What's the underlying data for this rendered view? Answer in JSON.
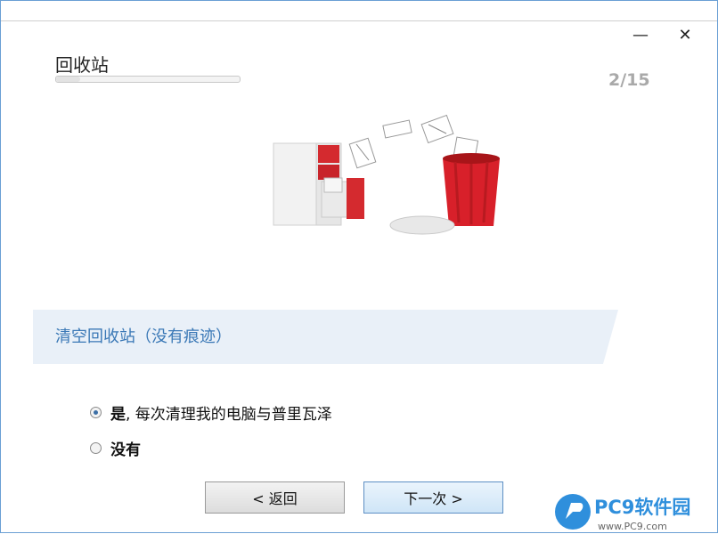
{
  "window": {
    "title": "回收站",
    "step": "2/15",
    "progress_fraction": 0.133
  },
  "section": {
    "heading": "清空回收站（没有痕迹）"
  },
  "options": [
    {
      "bold": "是",
      "text": ", 每次清理我的电脑与普里瓦泽",
      "selected": true
    },
    {
      "bold": "没有",
      "text": "",
      "selected": false
    }
  ],
  "buttons": {
    "back": "< 返回",
    "next": "下一次 >"
  },
  "watermark": {
    "text": "PC9软件园",
    "sub": "www.PC9.com"
  },
  "colors": {
    "accent": "#3a78b6",
    "banner": "#e9f0f8",
    "trash_red": "#d8202a"
  }
}
